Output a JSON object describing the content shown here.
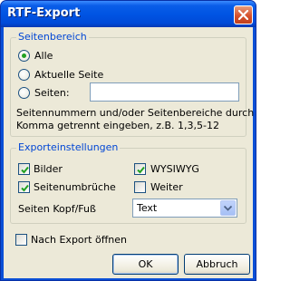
{
  "window": {
    "title": "RTF-Export"
  },
  "page_range": {
    "legend": "Seitenbereich",
    "options": [
      {
        "label": "Alle",
        "checked": true
      },
      {
        "label": "Aktuelle Seite",
        "checked": false
      },
      {
        "label": "Seiten:",
        "checked": false
      }
    ],
    "pages_input": {
      "value": ""
    },
    "hint_line1": "Seitennummern und/oder Seitenbereiche durch",
    "hint_line2": "Komma getrennt eingeben, z.B. 1,3,5-12"
  },
  "export_settings": {
    "legend": "Exporteinstellungen",
    "checkboxes": [
      {
        "label": "Bilder",
        "checked": true
      },
      {
        "label": "WYSIWYG",
        "checked": true
      },
      {
        "label": "Seitenumbrüche",
        "checked": true
      },
      {
        "label": "Weiter",
        "checked": false
      }
    ],
    "header_footer": {
      "label": "Seiten Kopf/Fuß",
      "value": "Text"
    }
  },
  "open_after_export": {
    "label": "Nach Export öffnen",
    "checked": false
  },
  "buttons": {
    "ok": "OK",
    "cancel": "Abbruch"
  },
  "colors": {
    "title_bar": "#0054e3",
    "dialog_bg": "#ece9d8",
    "legend_text": "#0046d5",
    "check_green": "#21a121"
  }
}
